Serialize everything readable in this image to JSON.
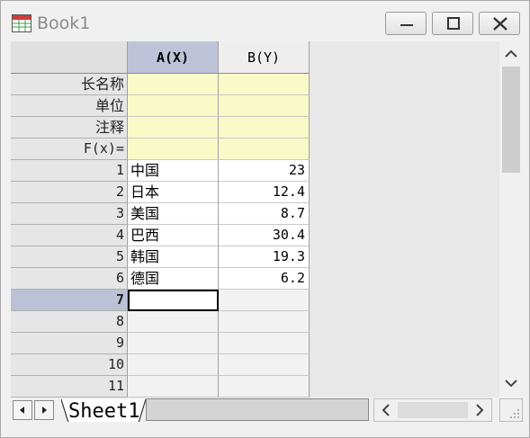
{
  "window": {
    "title": "Book1",
    "icon": "worksheet-icon",
    "buttons": {
      "minimize": "minimize-icon",
      "maximize": "maximize-icon",
      "close": "close-icon"
    }
  },
  "columns": {
    "a": "A(X)",
    "b": "B(Y)"
  },
  "meta_rows": [
    {
      "label": "长名称"
    },
    {
      "label": "单位"
    },
    {
      "label": "注释"
    },
    {
      "label": "F(x)="
    }
  ],
  "data_rows": [
    {
      "n": "1",
      "a": "中国",
      "b": "23"
    },
    {
      "n": "2",
      "a": "日本",
      "b": "12.4"
    },
    {
      "n": "3",
      "a": "美国",
      "b": "8.7"
    },
    {
      "n": "4",
      "a": "巴西",
      "b": "30.4"
    },
    {
      "n": "5",
      "a": "韩国",
      "b": "19.3"
    },
    {
      "n": "6",
      "a": "德国",
      "b": "6.2"
    }
  ],
  "empty_rows": [
    {
      "n": "7"
    },
    {
      "n": "8"
    },
    {
      "n": "9"
    },
    {
      "n": "10"
    },
    {
      "n": "11"
    }
  ],
  "active_row": "7",
  "sheet": {
    "tab_label": "Sheet1"
  },
  "colors": {
    "selected_header": "#bfc3d9",
    "meta_fill": "#fafac8"
  }
}
